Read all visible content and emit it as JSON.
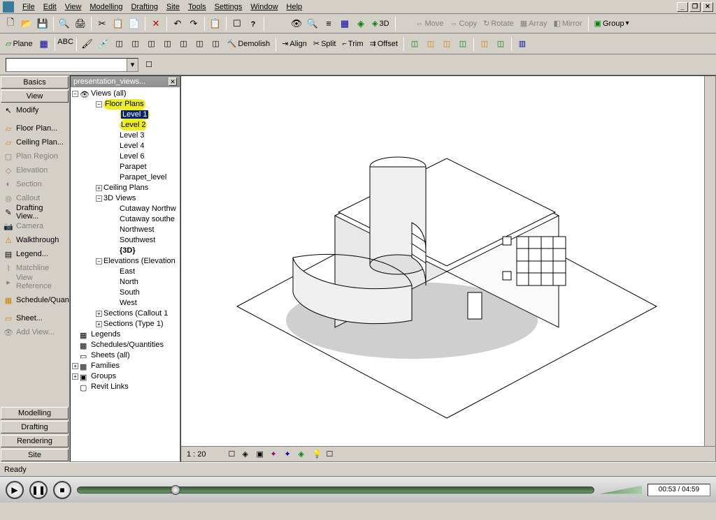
{
  "menu": {
    "items": [
      "File",
      "Edit",
      "View",
      "Modelling",
      "Drafting",
      "Site",
      "Tools",
      "Settings",
      "Window",
      "Help"
    ]
  },
  "toolbar1": {
    "labels": {
      "move": "Move",
      "copy": "Copy",
      "rotate": "Rotate",
      "array": "Array",
      "mirror": "Mirror",
      "group": "Group",
      "_3d": "3D"
    }
  },
  "toolbar2": {
    "labels": {
      "plane": "Plane",
      "demolish": "Demolish",
      "align": "Align",
      "split": "Split",
      "trim": "Trim",
      "offset": "Offset"
    }
  },
  "designbar": {
    "groups": [
      "Basics",
      "View"
    ],
    "current": "View",
    "items": [
      {
        "icon": "cursor",
        "label": "Modify",
        "disabled": false
      },
      {
        "icon": "floor",
        "label": "Floor Plan...",
        "disabled": false
      },
      {
        "icon": "ceiling",
        "label": "Ceiling Plan...",
        "disabled": false
      },
      {
        "icon": "region",
        "label": "Plan Region",
        "disabled": true
      },
      {
        "icon": "elev",
        "label": "Elevation",
        "disabled": true
      },
      {
        "icon": "section",
        "label": "Section",
        "disabled": true
      },
      {
        "icon": "callout",
        "label": "Callout",
        "disabled": true
      },
      {
        "icon": "draft",
        "label": "Drafting View...",
        "disabled": false
      },
      {
        "icon": "camera",
        "label": "Camera",
        "disabled": true
      },
      {
        "icon": "walk",
        "label": "Walkthrough",
        "disabled": false
      },
      {
        "icon": "legend",
        "label": "Legend...",
        "disabled": false
      },
      {
        "icon": "match",
        "label": "Matchline",
        "disabled": true
      },
      {
        "icon": "viewref",
        "label": "View Reference",
        "disabled": true
      },
      {
        "icon": "sched",
        "label": "Schedule/Quan",
        "disabled": false
      },
      {
        "icon": "sheet",
        "label": "Sheet...",
        "disabled": false
      },
      {
        "icon": "addview",
        "label": "Add View...",
        "disabled": true
      }
    ],
    "bottom_groups": [
      "Modelling",
      "Drafting",
      "Rendering",
      "Site"
    ]
  },
  "tree": {
    "title": "presentation_views...",
    "root": "Views (all)",
    "floor_plans": {
      "label": "Floor Plans",
      "items": [
        "Level 1",
        "Level 2",
        "Level 3",
        "Level 4",
        "Level 6",
        "Parapet",
        "Parapet_level"
      ],
      "selected": 0,
      "highlighted": [
        0,
        1
      ]
    },
    "ceiling_plans": "Ceiling Plans",
    "views3d": {
      "label": "3D Views",
      "items": [
        "Cutaway Northw",
        "Cutaway southe",
        "Northwest",
        "Southwest",
        "{3D}"
      ],
      "bold": 4
    },
    "elevations": {
      "label": "Elevations (Elevation",
      "items": [
        "East",
        "North",
        "South",
        "West"
      ]
    },
    "sections_callout": "Sections (Callout 1",
    "sections_type1": "Sections (Type 1)",
    "legends": "Legends",
    "schedules": "Schedules/Quantities",
    "sheets": "Sheets (all)",
    "families": "Families",
    "groups": "Groups",
    "revit_links": "Revit Links"
  },
  "viewstatus": {
    "scale": "1 : 20"
  },
  "statusbar": {
    "text": "Ready"
  },
  "playbar": {
    "time": "00:53 / 04:59"
  }
}
